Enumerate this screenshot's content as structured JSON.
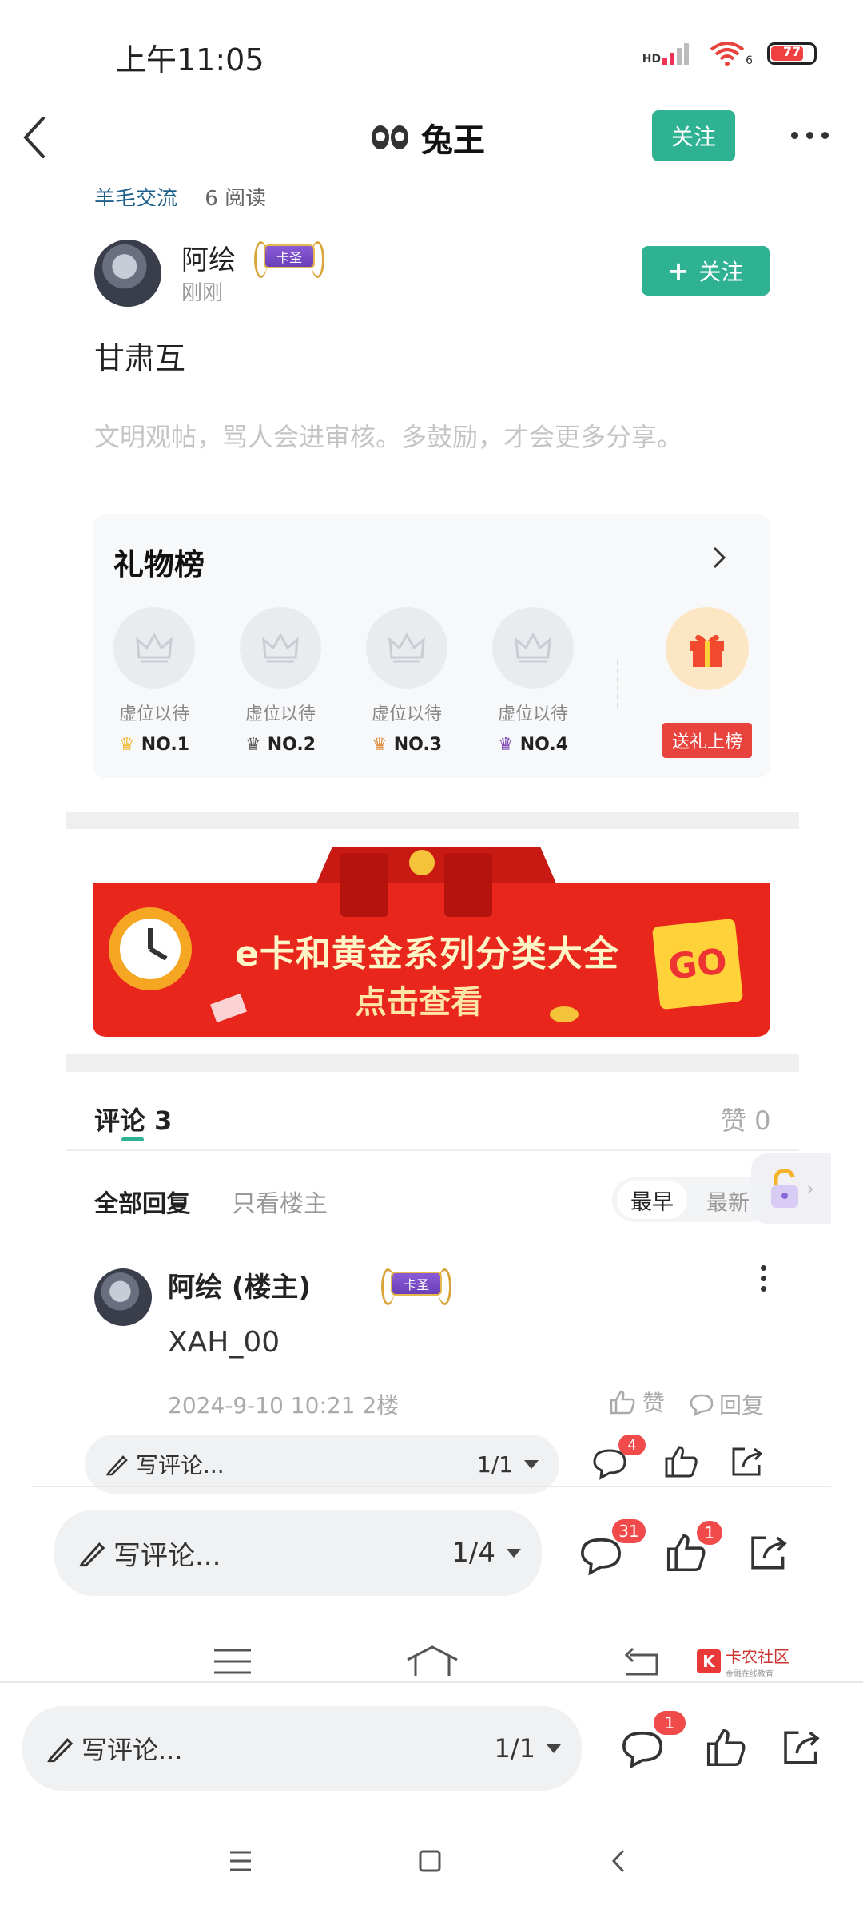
{
  "status_bar": {
    "time": "上午11:05",
    "network": "HD",
    "wifi_sub": "6",
    "battery": "77",
    "battery_level": 0.77
  },
  "header": {
    "title": "兔王",
    "follow": "关注"
  },
  "post": {
    "category": "羊毛交流",
    "reads": "6 阅读",
    "author": {
      "name": "阿绘",
      "badge": "卡圣",
      "time": "刚刚",
      "follow": "关注"
    },
    "title": "甘肃互",
    "hint": "文明观帖，骂人会进审核。多鼓励，才会更多分享。"
  },
  "gift_board": {
    "title": "礼物榜",
    "slots": [
      {
        "label": "虚位以待",
        "rank": "NO.1"
      },
      {
        "label": "虚位以待",
        "rank": "NO.2"
      },
      {
        "label": "虚位以待",
        "rank": "NO.3"
      },
      {
        "label": "虚位以待",
        "rank": "NO.4"
      }
    ],
    "send_button": "送礼上榜"
  },
  "banner": {
    "title": "e卡和黄金系列分类大全",
    "subtitle": "点击查看",
    "go": "GO"
  },
  "comments": {
    "tab": "评论 3",
    "likes": "赞 0",
    "filter_all": "全部回复",
    "filter_owner": "只看楼主",
    "sort_earliest": "最早",
    "sort_newest": "最新",
    "items": [
      {
        "name": "阿绘 (楼主)",
        "badge": "卡圣",
        "text": "XAH_00",
        "meta": "2024-9-10 10:21 2楼",
        "like": "赞",
        "reply": "回复"
      }
    ]
  },
  "bottom_bars": [
    {
      "placeholder": "写评论...",
      "page": "1/1",
      "comment_badge": "4",
      "like_badge": ""
    },
    {
      "placeholder": "写评论...",
      "page": "1/4",
      "comment_badge": "31",
      "like_badge": "1"
    },
    {
      "placeholder": "写评论...",
      "page": "1/1",
      "comment_badge": "1",
      "like_badge": ""
    }
  ],
  "watermark": {
    "name": "卡农社区",
    "sub": "金融在线教育"
  },
  "colors": {
    "accent": "#2fb292",
    "badge_red": "#f04a4a",
    "gift_red": "#e8433c",
    "banner_red": "#e8261c"
  }
}
